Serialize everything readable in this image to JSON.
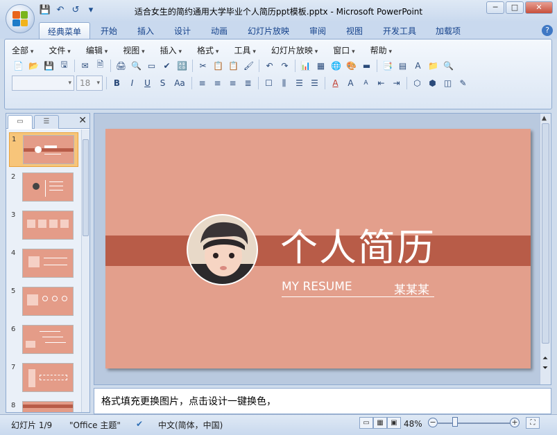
{
  "window": {
    "title": "适合女生的简约通用大学毕业个人简历ppt模板.pptx - Microsoft PowerPoint",
    "minimize": "─",
    "maximize": "□",
    "close": "✕"
  },
  "quick_access": [
    "💾",
    "↶",
    "↺",
    "▾"
  ],
  "ribbon_tabs": [
    "经典菜单",
    "开始",
    "插入",
    "设计",
    "动画",
    "幻灯片放映",
    "审阅",
    "视图",
    "开发工具",
    "加载项"
  ],
  "help_icon": "?",
  "menus": [
    "全部",
    "文件",
    "编辑",
    "视图",
    "插入",
    "格式",
    "工具",
    "幻灯片放映",
    "窗口",
    "帮助"
  ],
  "toolbar_row1": [
    "📄",
    "📂",
    "💾",
    "🖫",
    "✉",
    "🗎",
    "🖨",
    "🔍",
    "▭",
    "✔",
    "🔠",
    "✂",
    "📋",
    "📋",
    "🖌",
    "↶",
    "↷",
    "📊",
    "▦",
    "🌐",
    "🎨",
    "▬",
    "📑",
    "▤",
    "A",
    "📁",
    "🔍"
  ],
  "toolbar_row2": {
    "font_value": "",
    "size_value": "18",
    "buttons": [
      "B",
      "I",
      "U",
      "S",
      "Aa",
      "≡",
      "≡",
      "≡",
      "≣",
      "☐",
      "⫼",
      "☰",
      "☰",
      "A",
      "A",
      "A",
      "⇤",
      "⇥",
      "⬡",
      "⬢",
      "◫",
      "✎"
    ]
  },
  "left_panel": {
    "tab_slides": "▭",
    "tab_outline": "☰",
    "close": "✕",
    "thumbnails": [
      "1",
      "2",
      "3",
      "4",
      "5",
      "6",
      "7",
      "8"
    ]
  },
  "slide": {
    "title": "个人简历",
    "subtitle": "MY RESUME",
    "name": "某某某",
    "bg_color": "#e39f8c",
    "band_color": "#b85c48"
  },
  "notes": {
    "text": "格式填充更换图片，点击设计一键换色，"
  },
  "status": {
    "slide_label": "幻灯片 1/9",
    "theme": "\"Office 主题\"",
    "language": "中文(简体，中国)",
    "zoom": "48%"
  },
  "colors": {
    "accent": "#b85c48",
    "ribbon_text": "#15428b"
  }
}
